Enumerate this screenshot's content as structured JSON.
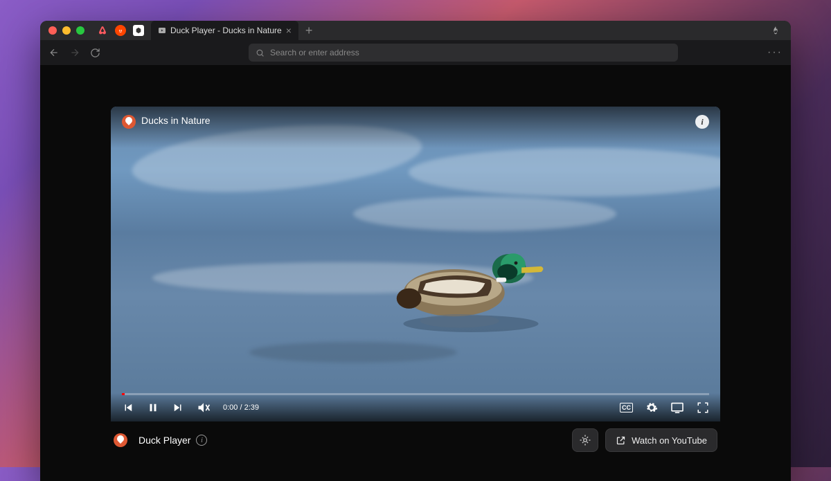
{
  "tab": {
    "title": "Duck Player - Ducks in Nature"
  },
  "addressbar": {
    "placeholder": "Search or enter address"
  },
  "video": {
    "title": "Ducks in Nature",
    "current_time": "0:00",
    "duration": "2:39"
  },
  "footer": {
    "app_name": "Duck Player",
    "watch_label": "Watch on YouTube"
  },
  "icons": {
    "pinned_airbnb": "airbnb-icon",
    "pinned_reddit": "reddit-icon",
    "pinned_site": "site-icon"
  }
}
